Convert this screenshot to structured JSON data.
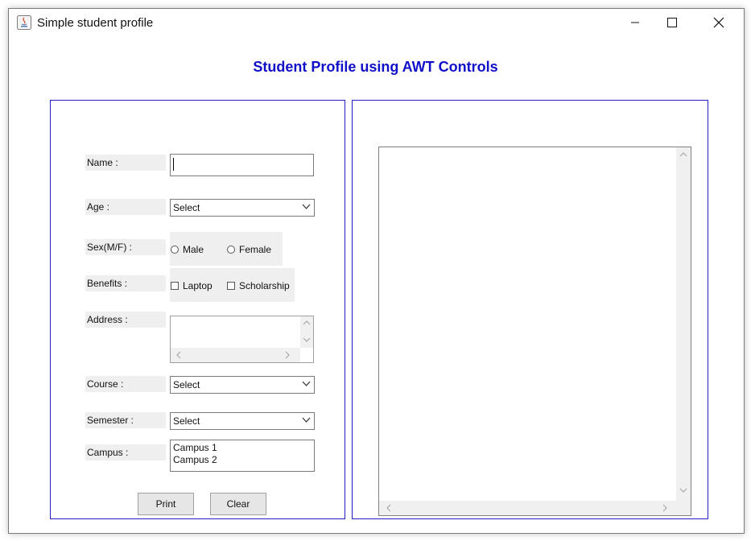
{
  "window": {
    "title": "Simple student profile"
  },
  "heading": "Student Profile using AWT Controls",
  "form": {
    "name_label": "Name :",
    "name_value": "",
    "age_label": "Age :",
    "age_value": "Select",
    "sex_label": "Sex(M/F) :",
    "sex_options": [
      "Male",
      "Female"
    ],
    "benefits_label": "Benefits :",
    "benefits_options": [
      "Laptop",
      "Scholarship"
    ],
    "address_label": "Address :",
    "course_label": "Course :",
    "course_value": "Select",
    "semester_label": "Semester :",
    "semester_value": "Select",
    "campus_label": "Campus :",
    "campus_items": [
      "Campus 1",
      "Campus 2"
    ],
    "print_label": "Print",
    "clear_label": "Clear"
  },
  "colors": {
    "accent": "#1010c8",
    "panel_border": "#2020c0"
  }
}
